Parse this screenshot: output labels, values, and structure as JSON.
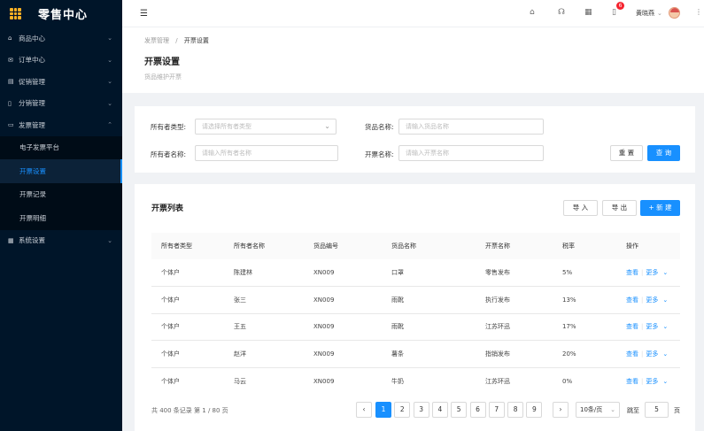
{
  "app": {
    "title": "零售中心"
  },
  "sidebar": {
    "items": [
      {
        "icon": "home-icon",
        "label": "商品中心"
      },
      {
        "icon": "mail-icon",
        "label": "订单中心"
      },
      {
        "icon": "calendar-icon",
        "label": "促销管理"
      },
      {
        "icon": "split-icon",
        "label": "分销管理"
      },
      {
        "icon": "monitor-icon",
        "label": "发票管理"
      }
    ],
    "subitems": [
      {
        "label": "电子发票平台"
      },
      {
        "label": "开票设置"
      },
      {
        "label": "开票记录"
      },
      {
        "label": "开票明细"
      }
    ],
    "last_item": {
      "icon": "grid-icon",
      "label": "系统设置"
    },
    "active_sub": "开票设置"
  },
  "header": {
    "notification_count": "6",
    "user_name": "黄晓燕"
  },
  "breadcrumb": {
    "parent": "发票管理",
    "sep": "/",
    "current": "开票设置"
  },
  "page": {
    "title": "开票设置",
    "description": "货品维护开票"
  },
  "search": {
    "owner_type_label": "所有者类型:",
    "owner_type_placeholder": "请选择所有者类型",
    "product_name_label": "货品名称:",
    "product_name_placeholder": "请输入货品名称",
    "owner_name_label": "所有者名称:",
    "owner_name_placeholder": "请输入所有者名称",
    "invoice_name_label": "开票名称:",
    "invoice_name_placeholder": "请输入开票名称",
    "reset_label": "重 置",
    "query_label": "查 询"
  },
  "table": {
    "title": "开票列表",
    "import_label": "导 入",
    "export_label": "导 出",
    "add_label": "+ 新 建",
    "columns": [
      "所有者类型",
      "所有者名称",
      "货品编号",
      "货品名称",
      "开票名称",
      "税率",
      "操作"
    ],
    "rows": [
      [
        "个体户",
        "陈建林",
        "XN009",
        "口罩",
        "零售发布",
        "5%"
      ],
      [
        "个体户",
        "张三",
        "XN009",
        "雨靴",
        "执行发布",
        "13%"
      ],
      [
        "个体户",
        "王五",
        "XN009",
        "雨靴",
        "江苏环迅",
        "17%"
      ],
      [
        "个体户",
        "赵洋",
        "XN009",
        "薯条",
        "指销发布",
        "20%"
      ],
      [
        "个体户",
        "马云",
        "XN009",
        "牛奶",
        "江苏环迅",
        "0%"
      ]
    ],
    "op_view": "查看",
    "op_more": "更多"
  },
  "pagination": {
    "summary": "共 400 条记录 第 1 / 80 页",
    "pages": [
      "1",
      "2",
      "3",
      "4",
      "5",
      "6",
      "7",
      "8",
      "9"
    ],
    "current": "1",
    "page_size": "10条/页",
    "jump_label": "跳至",
    "jump_value": "5",
    "page_suffix": "页"
  },
  "colors": {
    "accent": "#1890ff",
    "sidebar_bg": "#001529",
    "badge": "#f5222d"
  }
}
